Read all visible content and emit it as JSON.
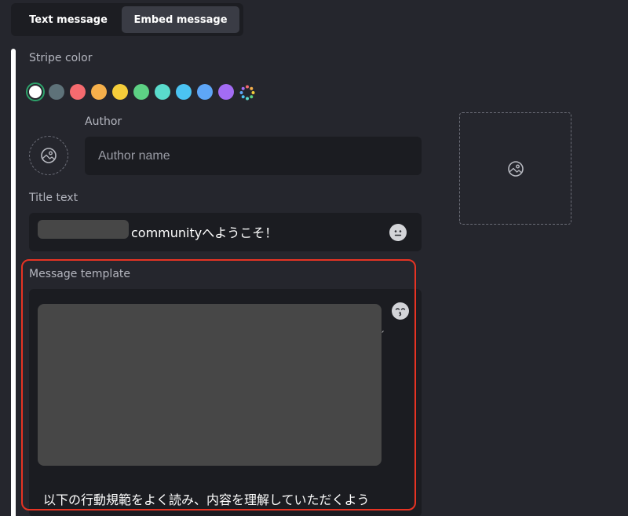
{
  "tabs": [
    {
      "label": "Text message",
      "active": false
    },
    {
      "label": "Embed message",
      "active": true
    }
  ],
  "stripe": {
    "label": "Stripe color",
    "selected_color": "#ffffff",
    "colors": [
      "#ffffff",
      "#5e7279",
      "#f56b6f",
      "#f6b04b",
      "#f5cd3a",
      "#5dd184",
      "#5adbcc",
      "#4bc3f2",
      "#5ea6f7",
      "#a36cf4"
    ],
    "custom_icon": "rainbow-dots-icon"
  },
  "author": {
    "label": "Author",
    "placeholder": "Author name",
    "value": "",
    "icon": "image-icon"
  },
  "title": {
    "label": "Title text",
    "value": "communityへようこそ！",
    "emoji_icon": "neutral-face-icon"
  },
  "template": {
    "label": "Message template",
    "visible_text": "以下の行動規範をよく読み、内容を理解していただくよう",
    "emoji_icon": "kissing-face-icon"
  },
  "thumbnail": {
    "icon": "image-icon"
  },
  "colors": {
    "background": "#25262d",
    "field": "#1b1c21",
    "highlight": "#e63323"
  }
}
